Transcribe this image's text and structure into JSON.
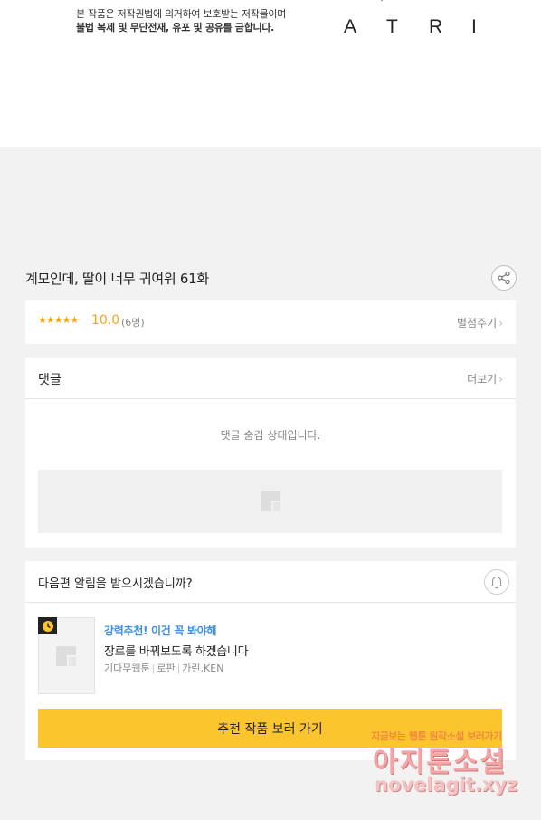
{
  "footer": {
    "copyright_line1": "본 작품은 저작권법에 의거하여 보호받는 저작물이며",
    "copyright_line2": "불법 복제 및 무단전재, 유포 및 공유를 금합니다.",
    "brand_letters": [
      "A",
      "T",
      "R",
      "I"
    ]
  },
  "episode": {
    "title": "계모인데, 딸이 너무 귀여워 61화",
    "share_icon": "share-icon"
  },
  "rating": {
    "stars": "★★★★★",
    "score": "10.0",
    "votes": "(6명)",
    "rate_label": "별점주기",
    "chevron": "›"
  },
  "comments": {
    "title": "댓글",
    "more_label": "더보기",
    "chevron": "›",
    "hidden_message": "댓글 숨김 상태입니다."
  },
  "notify": {
    "question": "다음편 알림을 받으시겠습니까?",
    "bell_icon": "bell-icon"
  },
  "recommendation": {
    "label": "강력추천! 이건 꼭 봐야해",
    "title": "장르를 바꿔보도록 하겠습니다",
    "meta": [
      "기다무웹툰",
      "로판",
      "가린,KEN"
    ],
    "cta_label": "추천 작품 보러 가기"
  },
  "watermark": {
    "line1": "지금보는 웹툰 원작소설 보러가기",
    "line2": "아지툰소설",
    "line3": "novelagit.xyz"
  },
  "colors": {
    "accent_yellow": "#fbc62d",
    "star_orange": "#f3a51a",
    "link_blue": "#3b8ee8",
    "background": "#f2f2f2"
  }
}
